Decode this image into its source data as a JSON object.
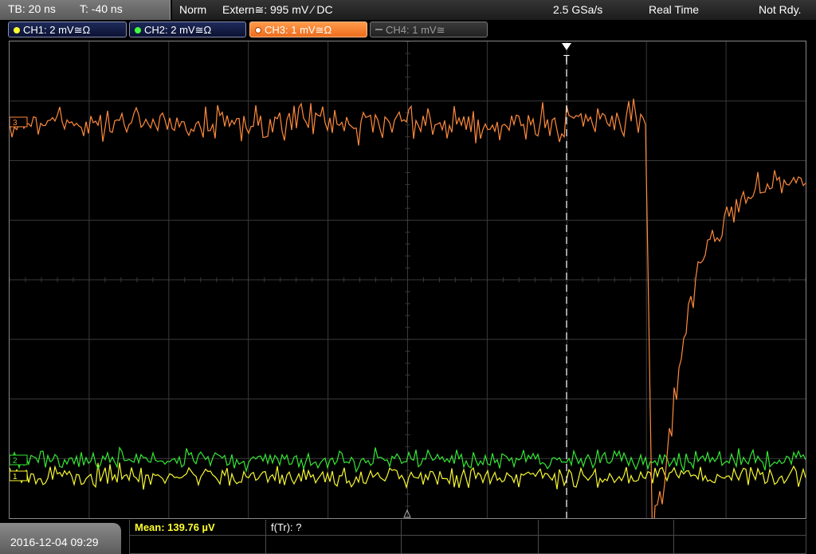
{
  "top_bar": {
    "timebase": "TB: 20 ns",
    "trigger_time": "T: -40 ns",
    "mode": "Norm",
    "trigger_source": "Extern≅: 995 mV ⁄ DC",
    "sample_rate": "2.5 GSa/s",
    "acquire_mode": "Real Time",
    "state": "Not Rdy."
  },
  "channels": [
    {
      "label": "CH1: 2 mV≅Ω",
      "color": "#ffff30",
      "active": true
    },
    {
      "label": "CH2: 2 mV≅Ω",
      "color": "#40ff40",
      "active": true
    },
    {
      "label": "CH3: 1 mV≅Ω",
      "color": "#ff8c3a",
      "active": true,
      "selected": true
    },
    {
      "label": "CH4: 1 mV≅",
      "color": "#888888",
      "active": false
    }
  ],
  "markers": {
    "trigger_label": "T",
    "ch1_marker": "1",
    "ch2_marker": "2",
    "ch3_marker": "3"
  },
  "bottom_bar": {
    "datetime": "2016-12-04 09:29",
    "measurement_1": "Mean: 139.76 µV",
    "measurement_2": "f(Tr): ?"
  },
  "colors": {
    "ch1": "#f8f830",
    "ch2": "#34e834",
    "ch3": "#ff8a3c",
    "grid": "#3a3a3a",
    "measurement_text": "#ffff30"
  }
}
